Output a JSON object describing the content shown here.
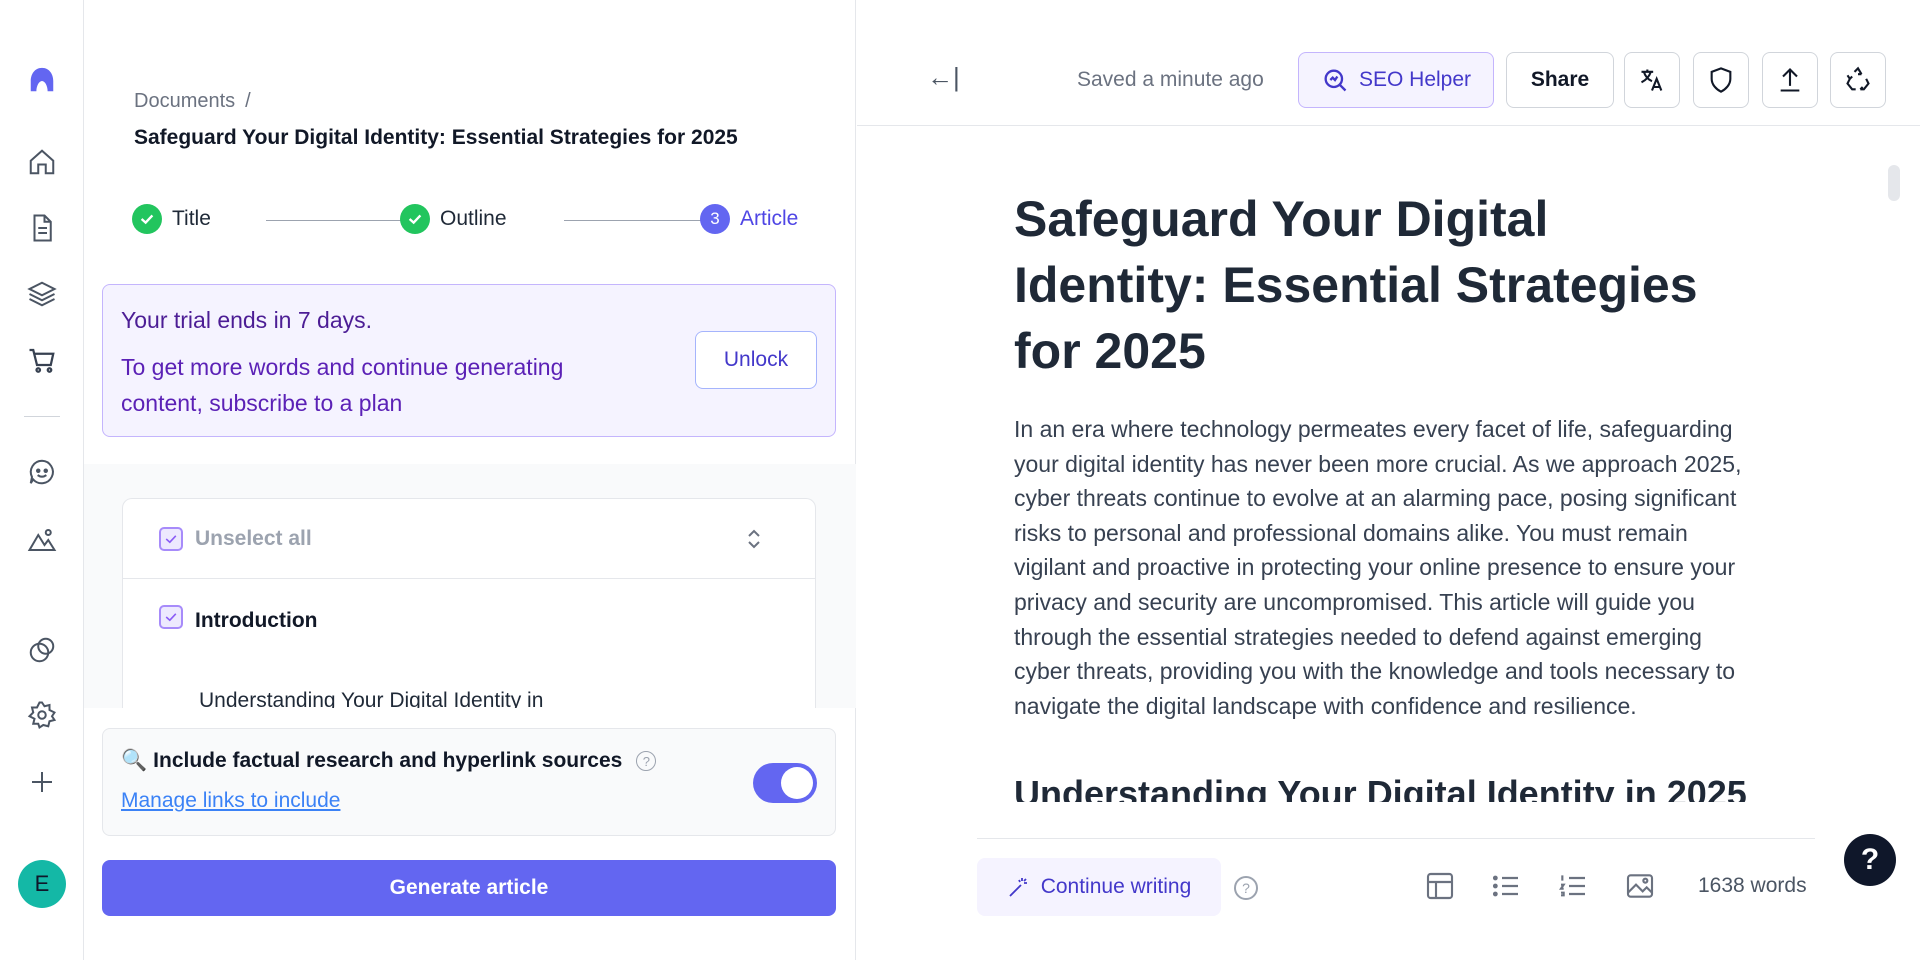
{
  "breadcrumb": {
    "root": "Documents",
    "separator": "/"
  },
  "doc_title": "Safeguard Your Digital Identity: Essential Strategies for 2025",
  "steps": [
    {
      "label": "Title",
      "state": "done"
    },
    {
      "label": "Outline",
      "state": "done"
    },
    {
      "label": "Article",
      "state": "current",
      "number": "3"
    }
  ],
  "trial": {
    "heading": "Your trial ends in 7 days.",
    "body": "To get more words and continue generating content, subscribe to a plan",
    "unlock_label": "Unlock"
  },
  "sections": {
    "unselect_all_label": "Unselect all",
    "items": [
      {
        "label": "Introduction",
        "checked": true
      },
      {
        "label": "Understanding Your Digital Identity in",
        "checked": false
      }
    ]
  },
  "research": {
    "label": "Include factual research and hyperlink sources",
    "icon": "magnifier-emoji",
    "link": "Manage links to include",
    "toggle_on": true
  },
  "generate_label": "Generate article",
  "topbar": {
    "collapse_glyph": "←|",
    "saved": "Saved a minute ago",
    "seo_label": "SEO Helper",
    "share_label": "Share"
  },
  "article": {
    "title": "Safeguard Your Digital Identity: Essential Strategies for 2025",
    "intro": "In an era where technology permeates every facet of life, safeguarding your digital identity has never been more crucial. As we approach 2025, cyber threats continue to evolve at an alarming pace, posing significant risks to personal and professional domains alike. You must remain vigilant and proactive in protecting your online presence to ensure your privacy and security are uncompromised. This article will guide you through the essential strategies needed to defend against emerging cyber threats, providing you with the knowledge and tools necessary to navigate the digital landscape with confidence and resilience.",
    "h2": "Understanding Your Digital Identity in 2025"
  },
  "bottom": {
    "continue_label": "Continue writing",
    "word_count": "1638 words"
  },
  "avatar_letter": "E",
  "help_fab": "?",
  "colors": {
    "accent": "#6366f1",
    "success": "#22c55e",
    "avatar": "#14b8a6"
  }
}
